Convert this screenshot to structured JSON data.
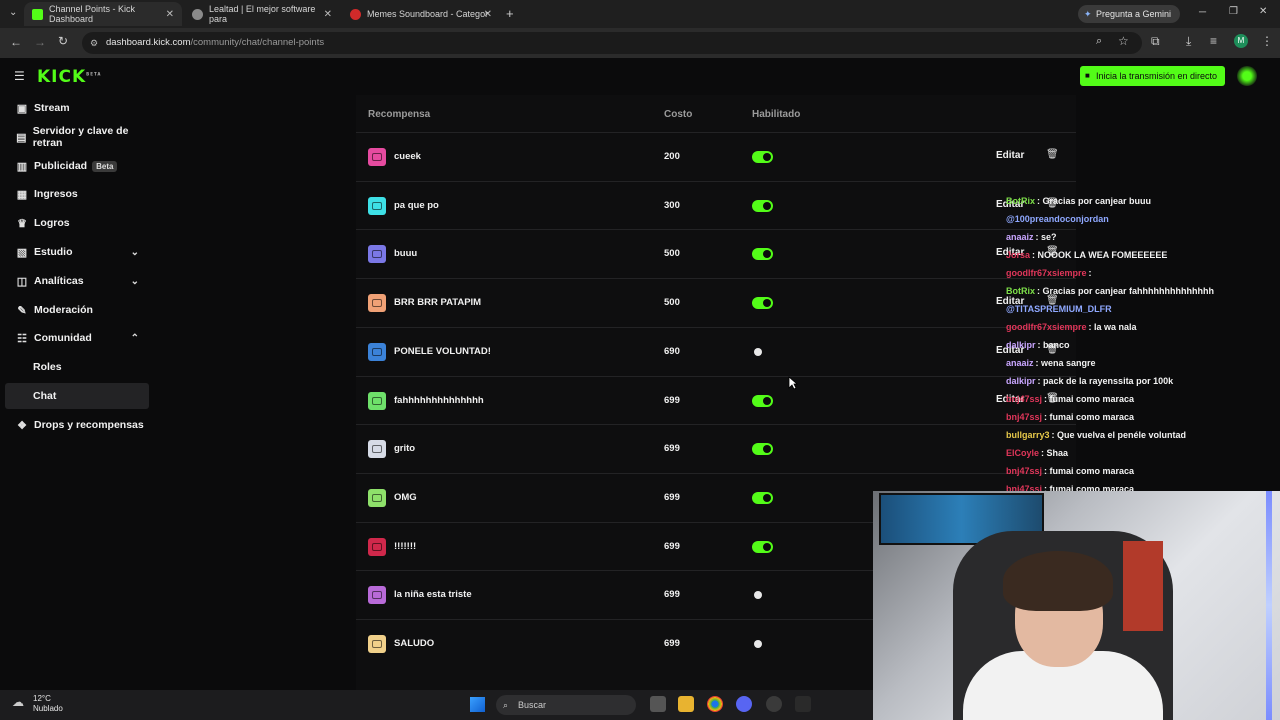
{
  "browser": {
    "tabs": [
      {
        "title": "Channel Points - Kick Dashboard",
        "close": "✕"
      },
      {
        "title": "Lealtad | El mejor software para",
        "close": "✕"
      },
      {
        "title": "Memes Soundboard - Categor",
        "close": "✕"
      }
    ],
    "new_tab": "+",
    "gemini_label": "Pregunta a Gemini",
    "url_host": "dashboard.kick.com",
    "url_path": "/community/chat/channel-points"
  },
  "header": {
    "logo": "KICK",
    "logo_sup": "BETA",
    "live_button": "Inicia la transmisión en directo"
  },
  "sidebar": {
    "items": [
      {
        "label": "Stream",
        "icon": "stream-icon",
        "glyph": "▣"
      },
      {
        "label": "Servidor y clave de retran",
        "icon": "server-icon",
        "glyph": "▤"
      },
      {
        "label": "Publicidad",
        "badge": "Beta",
        "icon": "ads-icon",
        "glyph": "▥"
      },
      {
        "label": "Ingresos",
        "icon": "income-icon",
        "glyph": "▦"
      },
      {
        "label": "Logros",
        "icon": "trophy-icon",
        "glyph": "♛"
      },
      {
        "label": "Estudio",
        "icon": "studio-icon",
        "glyph": "▧",
        "chevron": "⌄"
      },
      {
        "label": "Analíticas",
        "icon": "analytics-icon",
        "glyph": "◫",
        "chevron": "⌄"
      },
      {
        "label": "Moderación",
        "icon": "moderation-icon",
        "glyph": "✎"
      },
      {
        "label": "Comunidad",
        "icon": "community-icon",
        "glyph": "☷",
        "chevron": "⌃"
      },
      {
        "label": "Roles"
      },
      {
        "label": "Chat"
      },
      {
        "label": "Drops y recompensas",
        "icon": "drops-icon",
        "glyph": "❖"
      }
    ]
  },
  "table": {
    "headers": {
      "reward": "Recompensa",
      "cost": "Costo",
      "enabled": "Habilitado"
    },
    "edit_label": "Editar",
    "rows": [
      {
        "name": "cueek",
        "cost": "200",
        "enabled": true,
        "color": "#e64ba0"
      },
      {
        "name": "pa que po",
        "cost": "300",
        "enabled": true,
        "color": "#3ee0e6"
      },
      {
        "name": "buuu",
        "cost": "500",
        "enabled": true,
        "color": "#7b78e6"
      },
      {
        "name": "BRR BRR PATAPIM",
        "cost": "500",
        "enabled": true,
        "color": "#f0a176"
      },
      {
        "name": "PONELE VOLUNTAD!",
        "cost": "690",
        "enabled": false,
        "color": "#3b82d8"
      },
      {
        "name": "fahhhhhhhhhhhhhh",
        "cost": "699",
        "enabled": true,
        "color": "#6ee06a"
      },
      {
        "name": "grito",
        "cost": "699",
        "enabled": true,
        "color": "#d6dbe6"
      },
      {
        "name": "OMG",
        "cost": "699",
        "enabled": true,
        "color": "#8ee06a"
      },
      {
        "name": "!!!!!!!",
        "cost": "699",
        "enabled": true,
        "color": "#d0284b"
      },
      {
        "name": "la niña esta triste",
        "cost": "699",
        "enabled": false,
        "color": "#b86ad8"
      },
      {
        "name": "SALUDO",
        "cost": "699",
        "enabled": false,
        "color": "#f0d08a"
      }
    ]
  },
  "chat": {
    "lines": [
      {
        "user": "BotRix",
        "msg": ": Gracias por canjear buuu",
        "color": "#7ee04a"
      },
      {
        "user": "@100preandoconjordan",
        "msg": "",
        "color": "#8fa8ff"
      },
      {
        "user": "anaaiz",
        "msg": ": se?",
        "color": "#c9a6ff"
      },
      {
        "user": "Jorsa",
        "msg": ": NOOOK LA WEA FOMEEEEEE",
        "color": "#e0365a"
      },
      {
        "user": "goodlfr67xsiempre",
        "msg": ":",
        "color": "#e0365a"
      },
      {
        "user": "BotRix",
        "msg": ": Gracias por canjear fahhhhhhhhhhhhhh",
        "color": "#7ee04a"
      },
      {
        "user": "@TITASPREMIUM_DLFR",
        "msg": "",
        "color": "#8fa8ff"
      },
      {
        "user": "goodlfr67xsiempre",
        "msg": ": la wa nala",
        "color": "#e0365a"
      },
      {
        "user": "dalkipr",
        "msg": ": banco",
        "color": "#c9a6ff"
      },
      {
        "user": "anaaiz",
        "msg": ": wena sangre",
        "color": "#c9a6ff"
      },
      {
        "user": "dalkipr",
        "msg": ": pack de la rayenssita por 100k",
        "color": "#c9a6ff"
      },
      {
        "user": "bnj47ssj",
        "msg": ": fumai como maraca",
        "color": "#e0365a"
      },
      {
        "user": "bnj47ssj",
        "msg": ": fumai como maraca",
        "color": "#e0365a"
      },
      {
        "user": "bullgarry3",
        "msg": ": Que vuelva el penéle voluntad",
        "color": "#e6c84a"
      },
      {
        "user": "ElCoyle",
        "msg": ": Shaa",
        "color": "#e0365a"
      },
      {
        "user": "bnj47ssj",
        "msg": ": fumai como maraca",
        "color": "#e0365a"
      },
      {
        "user": "bnj47ssj",
        "msg": ": fumai como maraca",
        "color": "#e0365a"
      }
    ]
  },
  "taskbar": {
    "temperature": "12°C",
    "condition": "Nublado",
    "search_label": "Buscar"
  }
}
